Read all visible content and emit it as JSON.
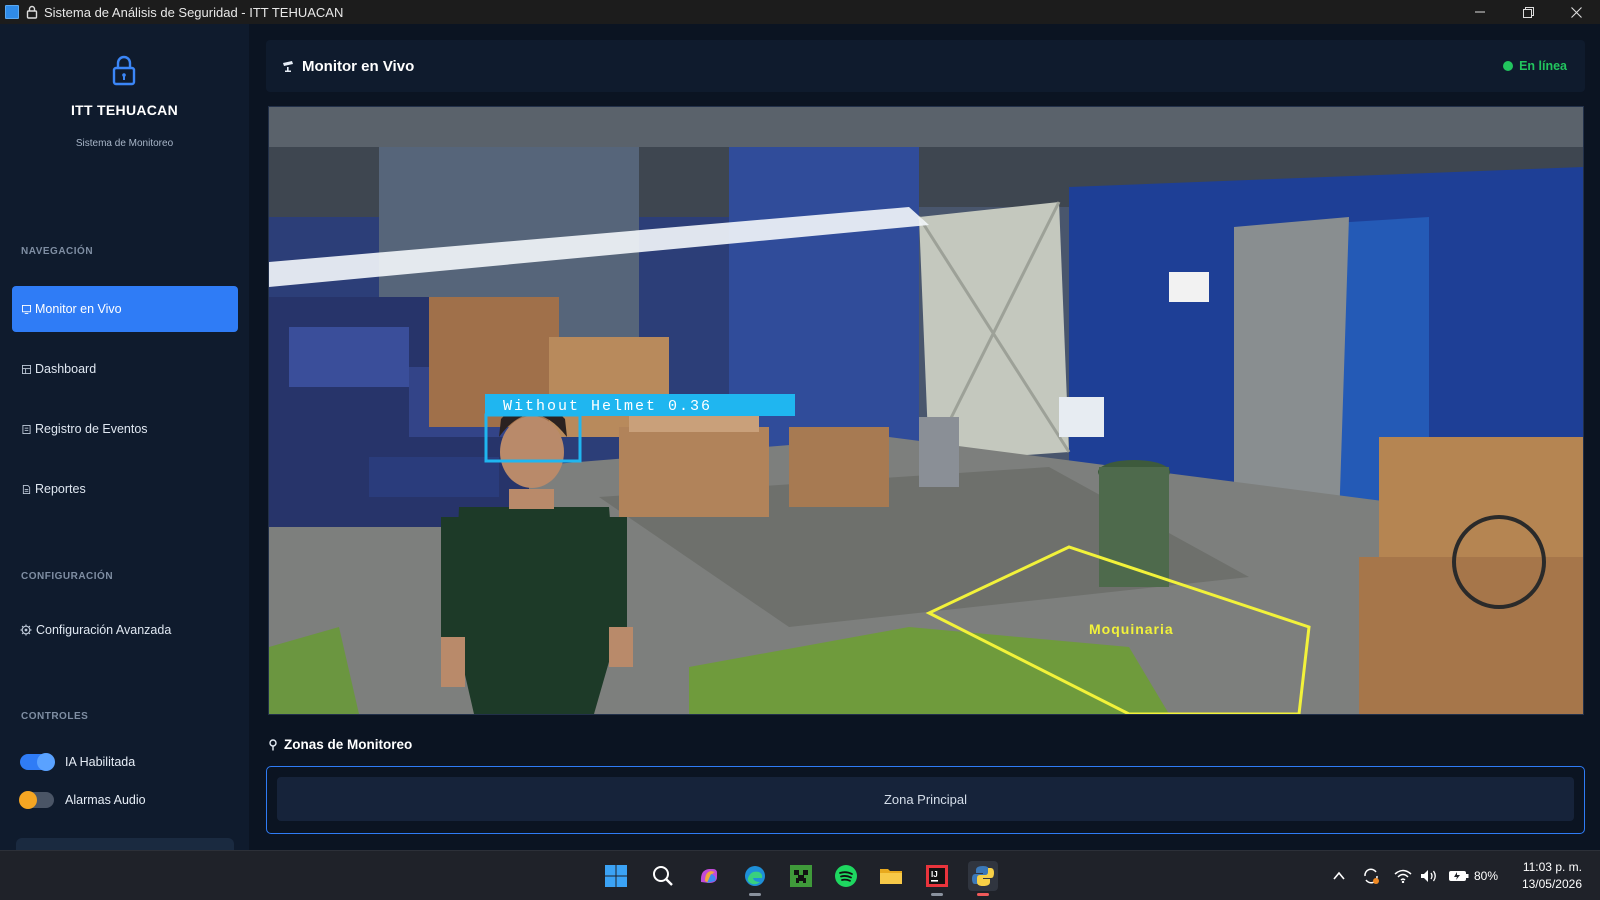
{
  "window": {
    "title": "Sistema de Análisis de Seguridad - ITT TEHUACAN",
    "controls": [
      "minimize-icon",
      "restore-icon",
      "close-icon"
    ]
  },
  "sidebar": {
    "brand_name": "ITT TEHUACAN",
    "brand_subtitle": "Sistema de Monitoreo",
    "nav_heading": "NAVEGACIÓN",
    "nav_items": [
      {
        "label": "Monitor en Vivo",
        "icon": "monitor-icon",
        "active": true
      },
      {
        "label": "Dashboard",
        "icon": "dashboard-icon",
        "active": false
      },
      {
        "label": "Registro de Eventos",
        "icon": "events-icon",
        "active": false
      },
      {
        "label": "Reportes",
        "icon": "reports-icon",
        "active": false
      }
    ],
    "config_heading": "CONFIGURACIÓN",
    "config_items": [
      {
        "label": "Configuración Avanzada",
        "icon": "gear-icon"
      }
    ],
    "controls_heading": "CONTROLES",
    "toggles": [
      {
        "label": "IA Habilitada",
        "on": true
      },
      {
        "label": "Alarmas Audio",
        "on": false
      }
    ]
  },
  "main": {
    "header_title": "Monitor en Vivo",
    "status_text": "En línea",
    "video": {
      "detection_label": "Without Helmet 0.36",
      "zone_label": "Moquinaria"
    },
    "zones_title": "Zonas de Monitoreo",
    "zones": [
      "Zona Principal"
    ]
  },
  "taskbar": {
    "apps": [
      "windows-start-icon",
      "search-icon",
      "copilot-icon",
      "edge-icon",
      "minecraft-icon",
      "spotify-icon",
      "file-explorer-icon",
      "jetbrains-icon",
      "python-icon"
    ],
    "battery": "80%",
    "time": "11:03 p. m.",
    "date": "13/05/2026"
  },
  "colors": {
    "accent": "#2f7cf6",
    "online": "#22c55e",
    "detection_box": "#1fb6f0",
    "zone_outline": "#f2f23a"
  }
}
